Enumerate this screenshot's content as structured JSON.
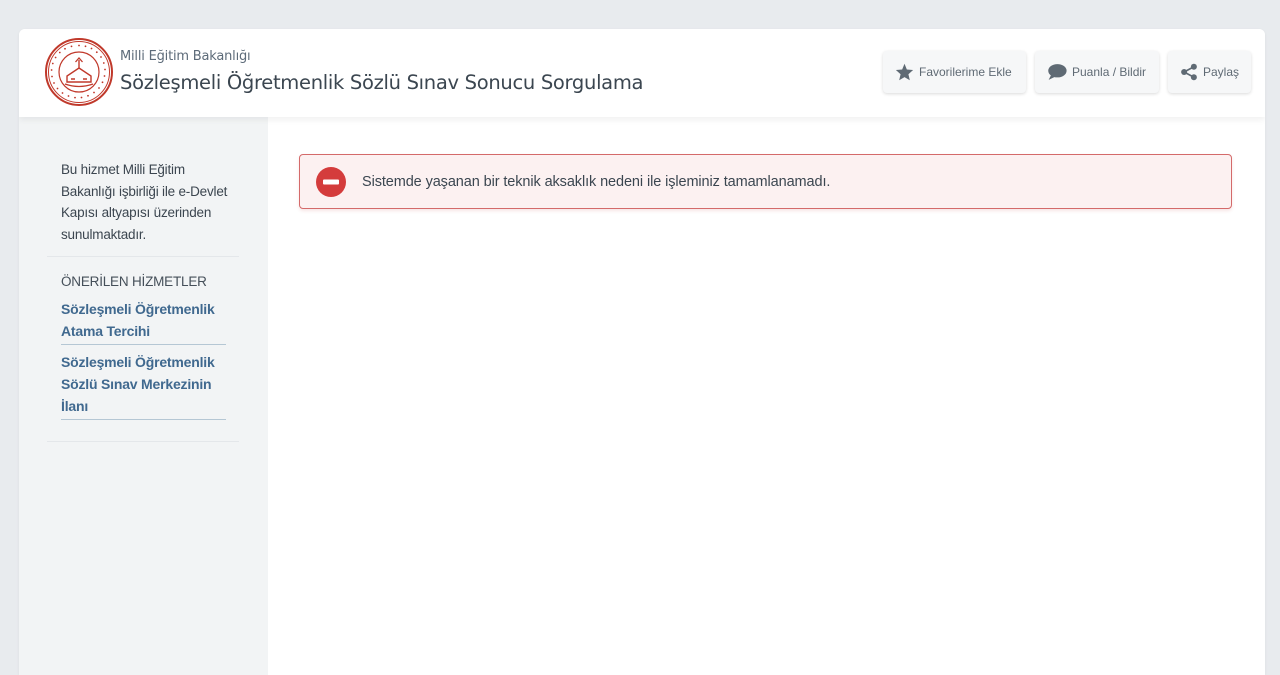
{
  "header": {
    "ministry": "Milli Eğitim Bakanlığı",
    "title": "Sözleşmeli Öğretmenlik Sözlü Sınav Sonucu Sorgulama",
    "buttons": {
      "favorites": "Favorilerime Ekle",
      "rate": "Puanla / Bildir",
      "share": "Paylaş"
    },
    "icons": {
      "logo": "meb-emblem-logo",
      "favorites": "star-icon",
      "rate": "speech-bubble-icon",
      "share": "share-icon"
    }
  },
  "sidebar": {
    "info": "Bu hizmet Milli Eğitim Bakanlığı işbirliği ile e-Devlet Kapısı altyapısı üzerinden sunulmaktadır.",
    "suggested_title": "ÖNERİLEN HİZMETLER",
    "suggested": [
      {
        "label": "Sözleşmeli Öğretmenlik Atama Tercihi"
      },
      {
        "label": "Sözleşmeli Öğretmenlik Sözlü Sınav Merkezinin İlanı"
      }
    ]
  },
  "alert": {
    "icon": "minus-circle-icon",
    "message": "Sistemde yaşanan bir teknik aksaklık nedeni ile işleminiz tamamlanamadı."
  },
  "colors": {
    "background": "#e8ebee",
    "sidebar": "#f2f4f5",
    "link": "#40698f",
    "alert_border": "#d46a6a",
    "alert_bg": "#fcf1f1",
    "alert_icon": "#d43c3c",
    "logo_red": "#c0392b"
  }
}
